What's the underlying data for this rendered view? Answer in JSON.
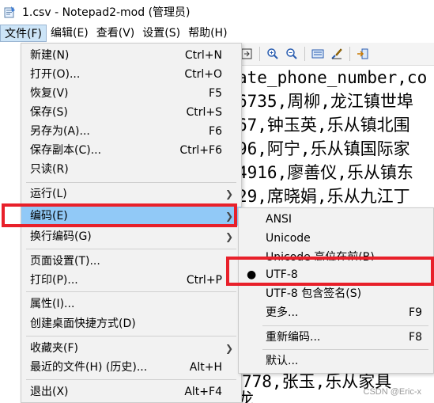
{
  "window": {
    "title": "1.csv - Notepad2-mod (管理员)"
  },
  "menubar": {
    "items": [
      "文件(F)",
      "编辑(E)",
      "查看(V)",
      "设置(S)",
      "帮助(H)"
    ]
  },
  "file_menu": {
    "items": [
      {
        "label": "新建(N)",
        "shortcut": "Ctrl+N"
      },
      {
        "label": "打开(O)...",
        "shortcut": "Ctrl+O"
      },
      {
        "label": "恢复(V)",
        "shortcut": "F5"
      },
      {
        "label": "保存(S)",
        "shortcut": "Ctrl+S"
      },
      {
        "label": "另存为(A)...",
        "shortcut": "F6"
      },
      {
        "label": "保存副本(C)...",
        "shortcut": "Ctrl+F6"
      },
      {
        "label": "只读(R)",
        "shortcut": ""
      },
      {
        "label": "运行(L)",
        "shortcut": ""
      },
      {
        "label": "编码(E)",
        "shortcut": ""
      },
      {
        "label": "换行编码(G)",
        "shortcut": ""
      },
      {
        "label": "页面设置(T)...",
        "shortcut": ""
      },
      {
        "label": "打印(P)...",
        "shortcut": "Ctrl+P"
      },
      {
        "label": "属性(I)...",
        "shortcut": ""
      },
      {
        "label": "创建桌面快捷方式(D)",
        "shortcut": ""
      },
      {
        "label": "收藏夹(F)",
        "shortcut": ""
      },
      {
        "label": "最近的文件(H) (历史)...",
        "shortcut": "Alt+H"
      },
      {
        "label": "退出(X)",
        "shortcut": "Alt+F4"
      }
    ]
  },
  "encoding_submenu": {
    "items": [
      {
        "label": "ANSI",
        "shortcut": ""
      },
      {
        "label": "Unicode",
        "shortcut": ""
      },
      {
        "label": "Unicode 高位在前(B)",
        "shortcut": ""
      },
      {
        "label": "UTF-8",
        "shortcut": "",
        "bullet": "●"
      },
      {
        "label": "UTF-8 包含签名(S)",
        "shortcut": ""
      },
      {
        "label": "更多...",
        "shortcut": "F9"
      },
      {
        "label": "重新编码...",
        "shortcut": "F8"
      },
      {
        "label": "默认...",
        "shortcut": ""
      }
    ]
  },
  "editor": {
    "lines": [
      "ate_phone_number,co",
      "6735,周柳,龙江镇世埠",
      "67,钟玉英,乐从镇北围",
      "96,阿宁,乐从镇国际家",
      "4916,廖善仪,乐从镇东",
      "29,席晓娟,乐从九江丁",
      "",
      "",
      "",
      "",
      "",
      "",
      "",
      "778,张玉,乐从家具",
      "龙"
    ]
  },
  "watermark": "CSDN @Eric-x",
  "colors": {
    "highlight": "#91c9f7",
    "red_box": "#e8202a",
    "menu_bg": "#f2f2f2"
  }
}
